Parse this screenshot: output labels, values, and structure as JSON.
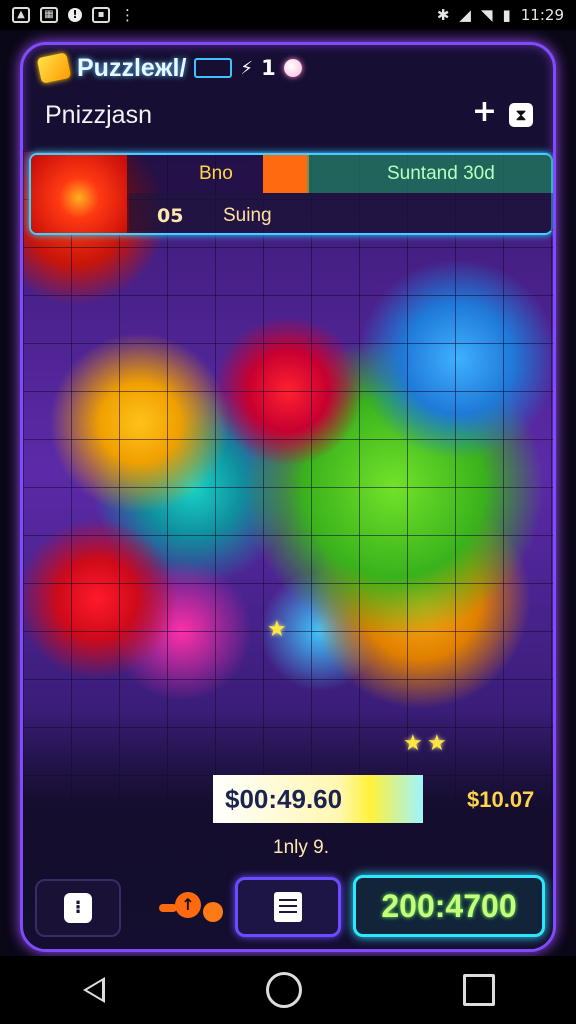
{
  "status_bar": {
    "time": "11:29",
    "notification_icons": [
      "image-icon",
      "gallery-icon",
      "alert-icon",
      "app-icon",
      "more-icon"
    ],
    "system_icons": [
      "bluetooth-icon",
      "signal-icon",
      "wifi-icon",
      "battery-icon"
    ]
  },
  "header": {
    "app_title": "Puzzleжl/",
    "count": "1",
    "subtitle": "Pnizzjasn"
  },
  "info_panel": {
    "label_left": "Bno",
    "label_right": "Suntand 30d",
    "value_left": "05",
    "value_right": "Suing"
  },
  "footer": {
    "price": "$00:49.60",
    "price_alt": "$10.07",
    "caption": "1nly 9.",
    "timer": "200:4700"
  },
  "colors": {
    "frame_glow": "#7f4bff",
    "cyan_glow": "#2ee6ff",
    "timer_text": "#c6ff7a",
    "price_gold": "#ffd34a"
  }
}
